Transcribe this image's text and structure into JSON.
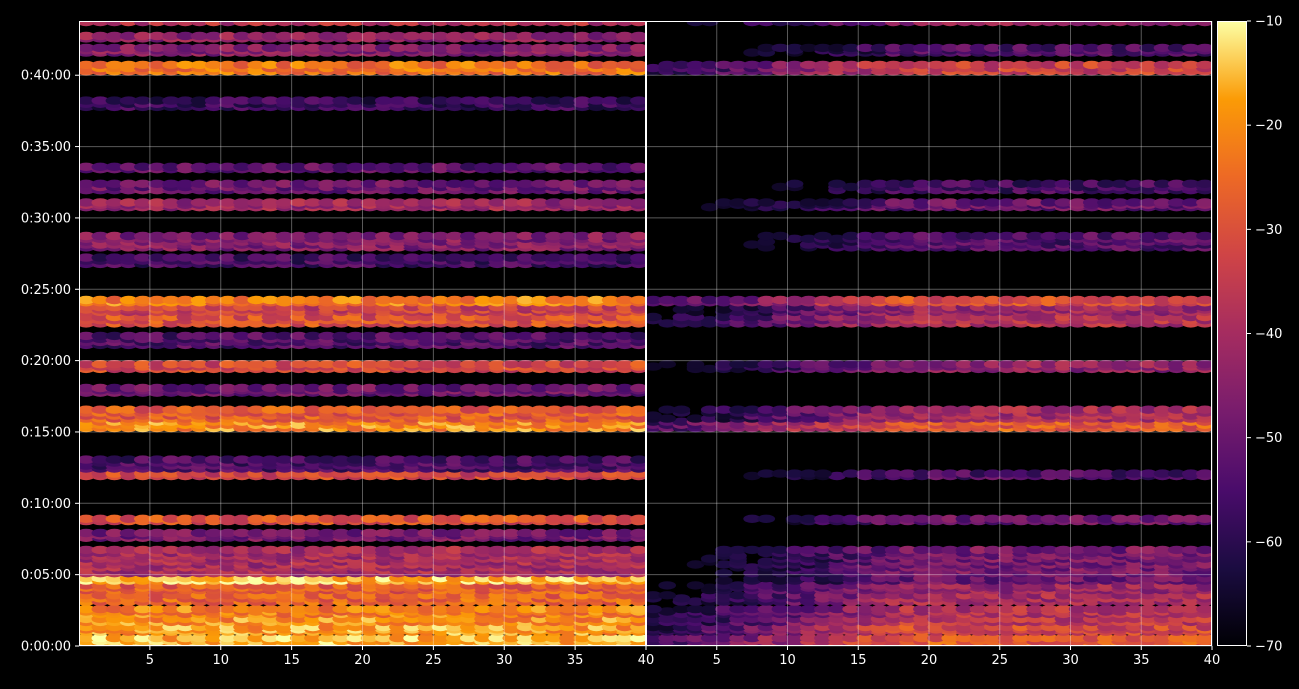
{
  "chart_data": {
    "type": "heatmap",
    "title": "",
    "colormap": "inferno",
    "background_color": "#000000",
    "foreground_color": "#ffffff",
    "panels": [
      {
        "name": "",
        "x_range": [
          1,
          40
        ],
        "x_ticks": [
          5,
          10,
          15,
          20,
          25,
          30,
          35,
          40
        ],
        "y_range_seconds": [
          0,
          2628
        ],
        "y_ticks": [
          "0:00:00",
          "0:05:00",
          "0:10:00",
          "0:15:00",
          "0:20:00",
          "0:25:00",
          "0:30:00",
          "0:35:00",
          "0:40:00"
        ],
        "grid": true,
        "band_profile": [
          {
            "start": "0:00:00",
            "end": "0:00:40",
            "level": -16
          },
          {
            "start": "0:00:55",
            "end": "0:01:25",
            "level": -18
          },
          {
            "start": "0:01:35",
            "end": "0:02:00",
            "level": -20
          },
          {
            "start": "0:02:10",
            "end": "0:02:40",
            "level": -22
          },
          {
            "start": "0:03:00",
            "end": "0:03:40",
            "level": -26
          },
          {
            "start": "0:03:50",
            "end": "0:04:20",
            "level": -28
          },
          {
            "start": "0:04:30",
            "end": "0:04:50",
            "level": -14
          },
          {
            "start": "0:05:00",
            "end": "0:06:50",
            "level": -40
          },
          {
            "start": "0:07:30",
            "end": "0:08:00",
            "level": -48
          },
          {
            "start": "0:08:40",
            "end": "0:09:00",
            "level": -30
          },
          {
            "start": "0:11:50",
            "end": "0:12:10",
            "level": -32
          },
          {
            "start": "0:12:20",
            "end": "0:13:10",
            "level": -55
          },
          {
            "start": "0:15:10",
            "end": "0:15:50",
            "level": -20
          },
          {
            "start": "0:15:50",
            "end": "0:16:40",
            "level": -28
          },
          {
            "start": "0:17:40",
            "end": "0:18:10",
            "level": -50
          },
          {
            "start": "0:19:20",
            "end": "0:19:50",
            "level": -32
          },
          {
            "start": "0:21:00",
            "end": "0:21:50",
            "level": -54
          },
          {
            "start": "0:22:30",
            "end": "0:23:10",
            "level": -30
          },
          {
            "start": "0:23:20",
            "end": "0:23:50",
            "level": -34
          },
          {
            "start": "0:24:00",
            "end": "0:24:20",
            "level": -22
          },
          {
            "start": "0:26:40",
            "end": "0:27:20",
            "level": -56
          },
          {
            "start": "0:27:50",
            "end": "0:28:50",
            "level": -46
          },
          {
            "start": "0:30:40",
            "end": "0:31:10",
            "level": -42
          },
          {
            "start": "0:31:50",
            "end": "0:32:30",
            "level": -50
          },
          {
            "start": "0:33:20",
            "end": "0:33:40",
            "level": -52
          },
          {
            "start": "0:37:40",
            "end": "0:38:20",
            "level": -58
          },
          {
            "start": "0:40:10",
            "end": "0:40:50",
            "level": -24
          },
          {
            "start": "0:41:30",
            "end": "0:42:00",
            "level": -46
          },
          {
            "start": "0:42:30",
            "end": "0:42:50",
            "level": -44
          },
          {
            "start": "0:43:40",
            "end": "0:43:48",
            "level": -38
          }
        ]
      },
      {
        "name": "",
        "x_range": [
          1,
          40
        ],
        "x_ticks": [
          5,
          10,
          15,
          20,
          25,
          30,
          35,
          40
        ],
        "y_range_seconds": [
          0,
          2628
        ],
        "grid": true,
        "band_profile": [
          {
            "start": "0:00:00",
            "end": "0:00:40",
            "level": -28
          },
          {
            "start": "0:00:55",
            "end": "0:01:25",
            "level": -32
          },
          {
            "start": "0:01:35",
            "end": "0:02:00",
            "level": -36
          },
          {
            "start": "0:02:10",
            "end": "0:02:40",
            "level": -38
          },
          {
            "start": "0:03:00",
            "end": "0:03:40",
            "level": -40
          },
          {
            "start": "0:03:50",
            "end": "0:04:20",
            "level": -42
          },
          {
            "start": "0:04:30",
            "end": "0:04:50",
            "level": -50
          },
          {
            "start": "0:05:00",
            "end": "0:06:50",
            "level": -48
          },
          {
            "start": "0:08:40",
            "end": "0:09:00",
            "level": -50
          },
          {
            "start": "0:11:50",
            "end": "0:12:10",
            "level": -54
          },
          {
            "start": "0:15:10",
            "end": "0:15:50",
            "level": -28
          },
          {
            "start": "0:15:50",
            "end": "0:16:40",
            "level": -40
          },
          {
            "start": "0:19:20",
            "end": "0:19:50",
            "level": -44
          },
          {
            "start": "0:22:30",
            "end": "0:23:10",
            "level": -38
          },
          {
            "start": "0:23:20",
            "end": "0:23:50",
            "level": -42
          },
          {
            "start": "0:24:00",
            "end": "0:24:20",
            "level": -30
          },
          {
            "start": "0:27:50",
            "end": "0:28:50",
            "level": -54
          },
          {
            "start": "0:30:40",
            "end": "0:31:10",
            "level": -50
          },
          {
            "start": "0:31:50",
            "end": "0:32:30",
            "level": -56
          },
          {
            "start": "0:40:10",
            "end": "0:40:50",
            "level": -34
          },
          {
            "start": "0:41:30",
            "end": "0:42:00",
            "level": -54
          },
          {
            "start": "0:43:40",
            "end": "0:43:48",
            "level": -44
          }
        ]
      }
    ],
    "colorbar": {
      "label": "",
      "range": [
        -70,
        -10
      ],
      "ticks": [
        "−10",
        "−20",
        "−30",
        "−40",
        "−50",
        "−60",
        "−70"
      ],
      "tick_values": [
        -10,
        -20,
        -30,
        -40,
        -50,
        -60,
        -70
      ]
    }
  }
}
